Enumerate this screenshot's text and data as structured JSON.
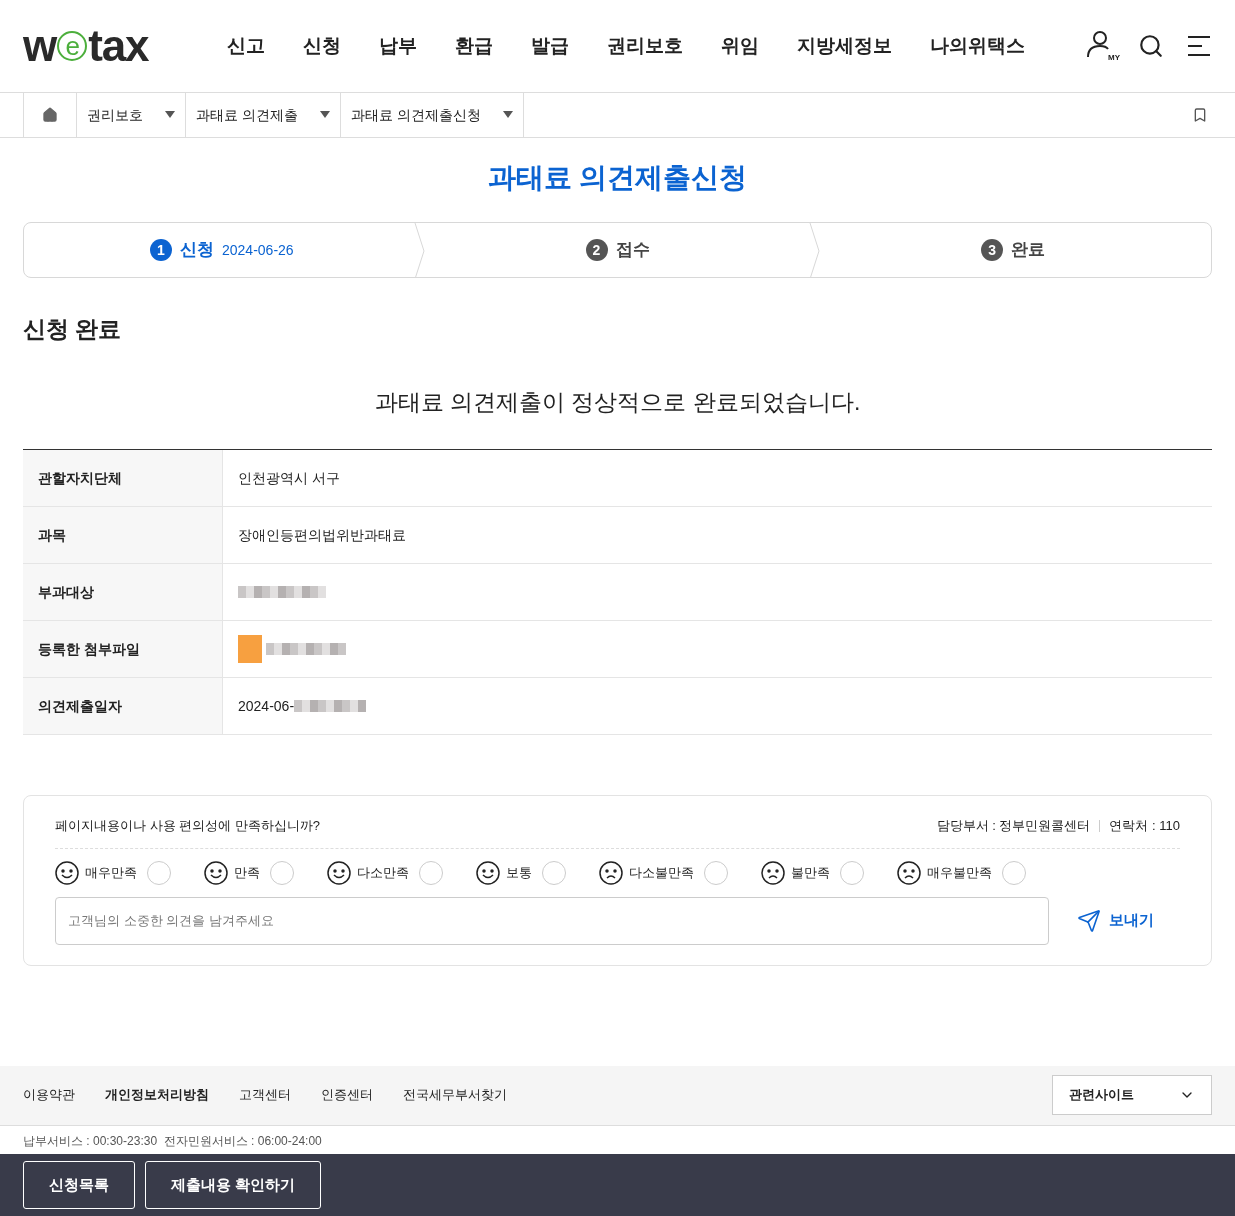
{
  "logo_parts": [
    "w",
    "e",
    "tax"
  ],
  "nav": [
    "신고",
    "신청",
    "납부",
    "환급",
    "발급",
    "권리보호",
    "위임",
    "지방세정보",
    "나의위택스"
  ],
  "user_badge": "MY",
  "breadcrumb": [
    "권리보호",
    "과태료 의견제출",
    "과태료 의견제출신청"
  ],
  "page_title": "과태료 의견제출신청",
  "steps": [
    {
      "number": "1",
      "label": "신청",
      "date": "2024-06-26",
      "selected": true
    },
    {
      "number": "2",
      "label": "접수",
      "selected": false
    },
    {
      "number": "3",
      "label": "완료",
      "selected": false
    }
  ],
  "section_title": "신청 완료",
  "message": "과태료 의견제출이 정상적으로 완료되었습니다.",
  "details": [
    {
      "label": "관할자치단체",
      "kind": "text",
      "value": "인천광역시 서구"
    },
    {
      "label": "과목",
      "kind": "text",
      "value": "장애인등편의법위반과태료"
    },
    {
      "label": "부과대상",
      "kind": "redacted"
    },
    {
      "label": "등록한 첨부파일",
      "kind": "file"
    },
    {
      "label": "의견제출일자",
      "kind": "partial",
      "value": "2024-06-"
    }
  ],
  "survey": {
    "question": "페이지내용이나 사용 편의성에 만족하십니까?",
    "department": "담당부서 : 정부민원콜센터",
    "contact": "연락처 : 110",
    "options": [
      {
        "label": "매우만족",
        "selected": false
      },
      {
        "label": "만족",
        "selected": false
      },
      {
        "label": "다소만족",
        "selected": false
      },
      {
        "label": "보통",
        "selected": false
      },
      {
        "label": "다소불만족",
        "selected": false
      },
      {
        "label": "불만족",
        "selected": false
      },
      {
        "label": "매우불만족",
        "selected": false
      }
    ],
    "placeholder": "고객님의 소중한 의견을 남겨주세요",
    "send": "보내기"
  },
  "footer_links": [
    {
      "label": "이용약관",
      "bold": false
    },
    {
      "label": "개인정보처리방침",
      "bold": true
    },
    {
      "label": "고객센터",
      "bold": false
    },
    {
      "label": "인증센터",
      "bold": false
    },
    {
      "label": "전국세무부서찾기",
      "bold": false
    }
  ],
  "related_sites": "관련사이트",
  "service_hours": "납부서비스 : 00:30-23:30  전자민원서비스 : 06:00-24:00",
  "bottom_buttons": [
    "신청목록",
    "제출내용 확인하기"
  ]
}
